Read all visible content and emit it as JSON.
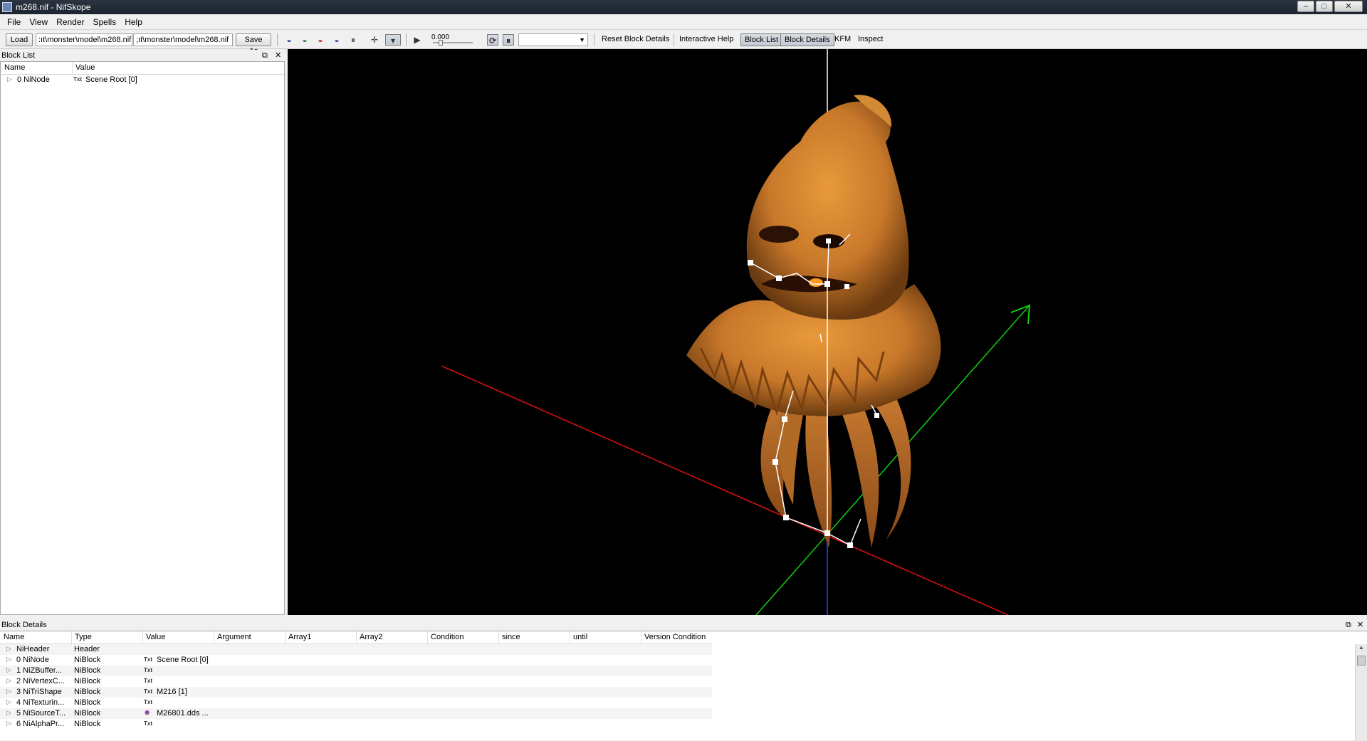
{
  "window": {
    "title": "m268.nif - NifSkope"
  },
  "menu": [
    "File",
    "View",
    "Render",
    "Spells",
    "Help"
  ],
  "toolbar": {
    "load_label": "Load",
    "load_path": ":ıt\\monster\\model\\m268.nif",
    "save_path": ";ıt\\monster\\model\\m268.nif",
    "save_as_label": "Save As",
    "time_value": "0.000",
    "reset_block_details": "Reset Block Details",
    "interactive_help": "Interactive Help",
    "block_list": "Block List",
    "block_details": "Block Details",
    "kfm": "KFM",
    "inspect": "Inspect"
  },
  "block_list": {
    "title": "Block List",
    "columns": [
      "Name",
      "Value"
    ],
    "rows": [
      {
        "name": "0 NiNode",
        "badge": "Txt",
        "value": "Scene Root [0]"
      }
    ]
  },
  "block_details": {
    "title": "Block Details",
    "columns": [
      "Name",
      "Type",
      "Value",
      "Argument",
      "Array1",
      "Array2",
      "Condition",
      "since",
      "until",
      "Version Condition"
    ],
    "rows": [
      {
        "name": "NiHeader",
        "type": "Header",
        "badge": "",
        "value": ""
      },
      {
        "name": "0 NiNode",
        "type": "NiBlock",
        "badge": "Txt",
        "value": "Scene Root [0]"
      },
      {
        "name": "1 NiZBuffer...",
        "type": "NiBlock",
        "badge": "Txt",
        "value": ""
      },
      {
        "name": "2 NiVertexC...",
        "type": "NiBlock",
        "badge": "Txt",
        "value": ""
      },
      {
        "name": "3 NiTriShape",
        "type": "NiBlock",
        "badge": "Txt",
        "value": "M216 [1]"
      },
      {
        "name": "4 NiTexturin...",
        "type": "NiBlock",
        "badge": "Txt",
        "value": ""
      },
      {
        "name": "5 NiSourceT...",
        "type": "NiBlock",
        "badge": "✸",
        "value": "M26801.dds ..."
      },
      {
        "name": "6 NiAlphaPr...",
        "type": "NiBlock",
        "badge": "Txt",
        "value": ""
      }
    ]
  },
  "colors": {
    "viewport_bg": "#000000",
    "x_axis": "#e01010",
    "y_axis": "#10d010",
    "z_axis": "#2030e0",
    "model": "#d98a2a"
  }
}
